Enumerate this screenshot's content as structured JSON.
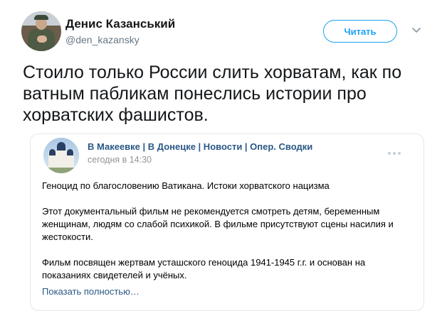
{
  "tweet": {
    "author_name": "Денис Казанський",
    "author_handle": "@den_kazansky",
    "follow_label": "Читать",
    "text": "Стоило только России слить хорватам, как по ватным пабликам понеслись истории про хорватских фашистов."
  },
  "card": {
    "group_name": "В Макеевке | В Донецке | Новости | Опер. Сводки",
    "post_time": "сегодня в 14:30",
    "paragraphs": [
      "Геноцид по благословению Ватикана. Истоки хорватского нацизма",
      "Этот документальный фильм не рекомендуется смотреть детям, беременным женщинам, людям со слабой психикой. В фильме присутствуют сцены насилия и жестокости.",
      "Фильм посвящен жертвам усташского геноцида 1941-1945 г.г. и основан на показаниях свидетелей и учёных."
    ],
    "show_more_label": "Показать полностью…"
  },
  "colors": {
    "twitter_blue": "#1da1f2",
    "vk_link_blue": "#2a5885",
    "muted_gray": "#657786"
  }
}
